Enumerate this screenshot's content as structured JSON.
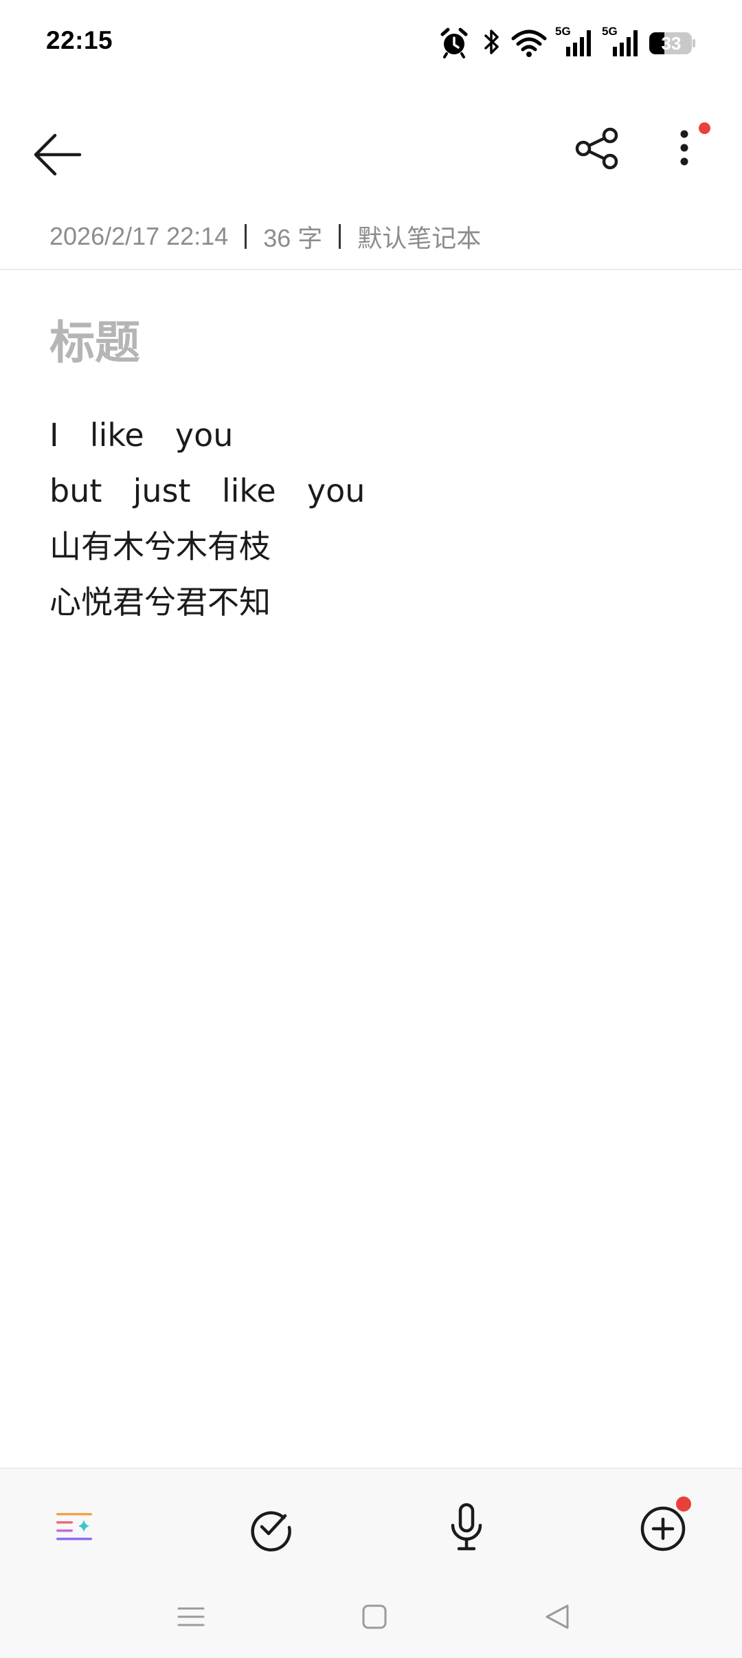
{
  "status_bar": {
    "time": "22:15",
    "battery_level": "33",
    "network_1": "5G",
    "network_2": "5G",
    "icons": [
      "alarm-icon",
      "bluetooth-icon",
      "wifi-icon",
      "signal-5g-icon",
      "signal-5g-icon",
      "battery-icon"
    ]
  },
  "toolbar": {
    "back_icon": "arrow-left-icon",
    "share_icon": "share-icon",
    "more_icon": "more-vertical-icon",
    "notification_dot_color": "#e8413a"
  },
  "note": {
    "meta": {
      "datetime": "2026/2/17 22:14",
      "word_count": "36 字",
      "notebook": "默认笔记本"
    },
    "title_placeholder": "标题",
    "lines": [
      "I  like  you",
      "but  just  like  you",
      "山有木兮木有枝",
      "心悦君兮君不知"
    ]
  },
  "bottom_toolbar": {
    "tools": [
      "ai-format-icon",
      "todo-check-icon",
      "microphone-icon",
      "add-circle-icon"
    ]
  },
  "nav_bar": {
    "buttons": [
      "menu-icon",
      "home-icon",
      "back-triangle-icon"
    ]
  }
}
